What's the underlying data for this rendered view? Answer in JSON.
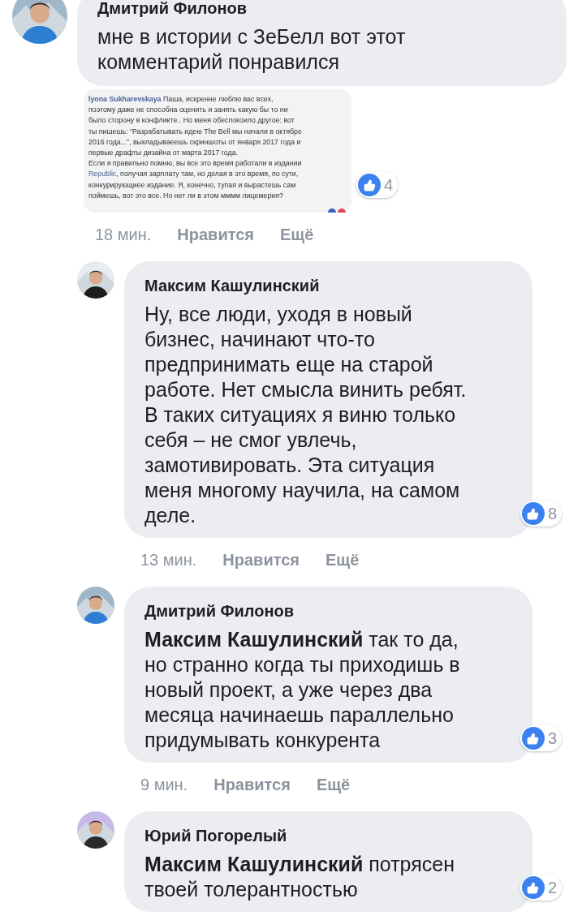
{
  "comments": [
    {
      "author": "Дмитрий Филонов",
      "reply": false,
      "text": "мне в истории с ЗеБелл вот этот\nкомментарий понравился",
      "attachment": {
        "author": "lyona Sukharevskaya",
        "text_before_link": " Паша, искренне люблю вас всех,\nпоэтому даже не способна оценить и занять какую бы то ни\nбыло сторону в конфликте.. Но меня обеспокоило другое: вот\nты пишешь: “Разрабатывать идею The Bell мы начали в октябре\n2016 года...”, выкладываеешь скриншоты от января 2017 года и\nпервые драфты дизайна от марта 2017 года.\nЕсли я правильно помню, вы все это время работали в издании\n",
        "link": "Republic",
        "text_after_link": ", получая зарплату там, но делая в это время, по сути,\nконкурирующиее издание. Я, конечно, тупая и вырастешь сам\nпоймешь, вот это все. Но нет ли в этом мммм лицемерия?"
      },
      "reactions": "4",
      "time": "18 мин.",
      "actions": [
        "Нравится",
        "Ещё"
      ]
    },
    {
      "author": "Максим Кашулинский",
      "reply": true,
      "text": "Ну, все люди, уходя в новый\nбизнес, начинают что-то\nпредпринимать еще на старой\nработе. Нет смысла винить ребят.\nВ таких ситуациях я виню только\nсебя – не смог увлечь,\nзамотивировать. Эта ситуация\nменя многому научила, на самом\nделе.",
      "reactions": "8",
      "time": "13 мин.",
      "actions": [
        "Нравится",
        "Ещё"
      ]
    },
    {
      "author": "Дмитрий Филонов",
      "reply": true,
      "text": "**Максим Кашулинский** так то да,\nно странно когда ты приходишь в\nновый проект, а уже через два\nмесяца начинаешь параллельно\nпридумывать конкурента",
      "reactions": "3",
      "time": "9 мин.",
      "actions": [
        "Нравится",
        "Ещё"
      ]
    },
    {
      "author": "Юрий Погорелый",
      "reply": true,
      "text": "**Максим Кашулинский** потрясен\nтвоей толерантностью",
      "reactions": "2"
    }
  ]
}
